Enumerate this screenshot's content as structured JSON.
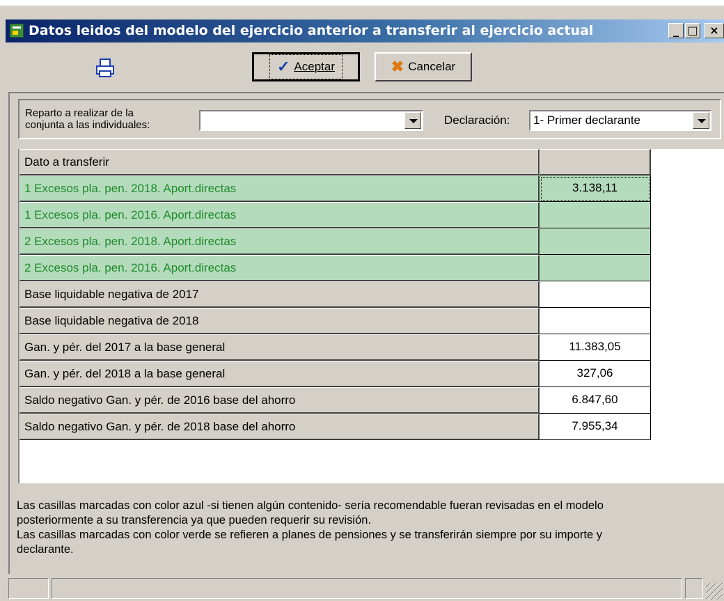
{
  "window": {
    "title": "Datos leidos del modelo del ejercicio anterior a transferir al ejercicio actual",
    "controls": {
      "minimize": "_",
      "maximize": "□",
      "close": "×"
    }
  },
  "toolbar": {
    "print_icon": "printer-icon",
    "accept_label": "Aceptar",
    "accept_icon": "checkmark-icon",
    "cancel_label": "Cancelar",
    "cancel_icon": "cancel-x-icon"
  },
  "filter": {
    "reparto_label_line1": "Reparto a realizar de la",
    "reparto_label_line2": "conjunta a las individuales:",
    "reparto_value": "",
    "declaracion_label": "Declaración:",
    "declaracion_value": "1- Primer declarante"
  },
  "grid": {
    "header": {
      "col1": "Dato a transferir",
      "col2": ""
    },
    "rows": [
      {
        "label": "1 Excesos pla. pen. 2018. Aport.directas",
        "value": "3.138,11",
        "style": "green"
      },
      {
        "label": "1 Excesos pla. pen. 2016. Aport.directas",
        "value": "",
        "style": "green"
      },
      {
        "label": "2 Excesos pla. pen. 2018. Aport.directas",
        "value": "",
        "style": "green"
      },
      {
        "label": "2 Excesos pla. pen. 2016. Aport.directas",
        "value": "",
        "style": "green"
      },
      {
        "label": "Base liquidable negativa de 2017",
        "value": "",
        "style": "normal"
      },
      {
        "label": "Base liquidable negativa de 2018",
        "value": "",
        "style": "normal"
      },
      {
        "label": "Gan. y pér. del 2017 a la base general",
        "value": "11.383,05",
        "style": "normal"
      },
      {
        "label": "Gan. y pér. del 2018 a la base general",
        "value": "327,06",
        "style": "normal"
      },
      {
        "label": "Saldo negativo Gan. y pér. de 2016 base del ahorro",
        "value": "6.847,60",
        "style": "normal"
      },
      {
        "label": "Saldo negativo Gan. y pér. de 2018 base del ahorro",
        "value": "7.955,34",
        "style": "normal"
      }
    ]
  },
  "note": {
    "line1": "Las casillas marcadas con color azul -si tienen algún contenido- sería recomendable fueran revisadas en el modelo",
    "line2": "posteriormente a su transferencia ya que pueden requerir su revisión.",
    "line3": "Las casillas marcadas con color verde se refieren a planes de pensiones y se transferirán siempre por su importe y",
    "line4": "declarante."
  },
  "colors": {
    "green_row_bg": "#b4dcbc",
    "green_row_text": "#208a2c",
    "titlebar_start": "#0a246a",
    "titlebar_end": "#a6caf0"
  }
}
